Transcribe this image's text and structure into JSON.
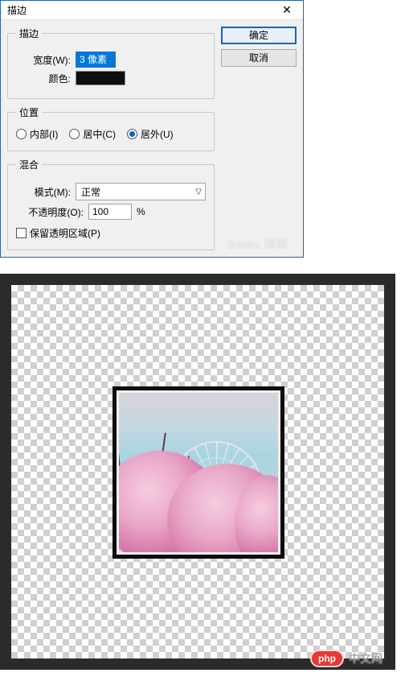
{
  "dialog": {
    "title": "描边",
    "close_icon": "✕",
    "stroke_fieldset": {
      "legend": "描边",
      "width_label": "宽度(W):",
      "width_value": "3 像素",
      "color_label": "颜色:",
      "color_value": "#0e0e0e"
    },
    "position_fieldset": {
      "legend": "位置",
      "options": {
        "inside": {
          "label": "内部(I)",
          "checked": false
        },
        "center": {
          "label": "居中(C)",
          "checked": false
        },
        "outside": {
          "label": "居外(U)",
          "checked": true
        }
      }
    },
    "blend_fieldset": {
      "legend": "混合",
      "mode_label": "模式(M):",
      "mode_value": "正常",
      "opacity_label": "不透明度(O):",
      "opacity_value": "100",
      "opacity_unit": "%",
      "preserve_label": "保留透明区域(P)",
      "preserve_checked": false
    },
    "buttons": {
      "ok": "确定",
      "cancel": "取消"
    },
    "watermark": "Baidu 经验"
  },
  "preview": {
    "badge_logo": "php",
    "badge_text": "中文网"
  }
}
